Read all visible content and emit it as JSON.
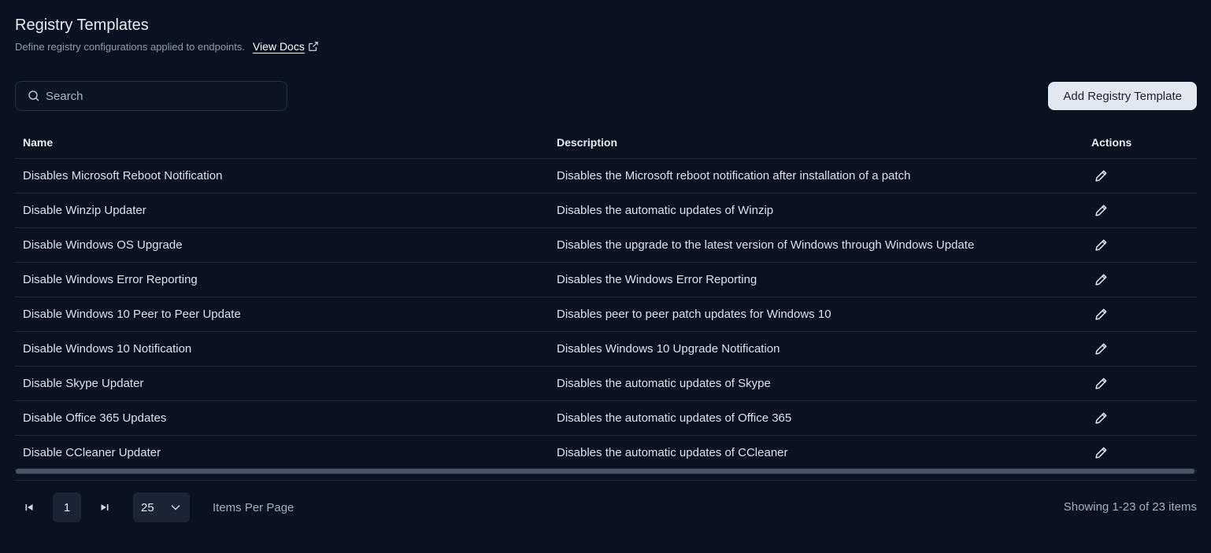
{
  "header": {
    "title": "Registry Templates",
    "subtitle": "Define registry configurations applied to endpoints.",
    "docs_link": "View Docs"
  },
  "search": {
    "placeholder": "Search",
    "value": ""
  },
  "toolbar": {
    "add_label": "Add Registry Template"
  },
  "table": {
    "columns": {
      "name": "Name",
      "description": "Description",
      "actions": "Actions"
    },
    "rows": [
      {
        "name": "Disables Microsoft Reboot Notification",
        "description": "Disables the Microsoft reboot notification after installation of a patch"
      },
      {
        "name": "Disable Winzip Updater",
        "description": "Disables the automatic updates of Winzip"
      },
      {
        "name": "Disable Windows OS Upgrade",
        "description": "Disables the upgrade to the latest version of Windows through Windows Update"
      },
      {
        "name": "Disable Windows Error Reporting",
        "description": "Disables the Windows Error Reporting"
      },
      {
        "name": "Disable Windows 10 Peer to Peer Update",
        "description": "Disables peer to peer patch updates for Windows 10"
      },
      {
        "name": "Disable Windows 10 Notification",
        "description": "Disables Windows 10 Upgrade Notification"
      },
      {
        "name": "Disable Skype Updater",
        "description": "Disables the automatic updates of Skype"
      },
      {
        "name": "Disable Office 365 Updates",
        "description": "Disables the automatic updates of Office 365"
      },
      {
        "name": "Disable CCleaner Updater",
        "description": "Disables the automatic updates of CCleaner"
      }
    ],
    "action_icon": "pencil-edit-icon"
  },
  "pagination": {
    "current_page": "1",
    "per_page": "25",
    "per_page_label": "Items Per Page",
    "showing": "Showing 1-23 of 23 items"
  },
  "colors": {
    "background": "#0a1120",
    "button_bg": "#e3e7ef",
    "border": "#1f2838",
    "muted_text": "#a4aec0"
  }
}
